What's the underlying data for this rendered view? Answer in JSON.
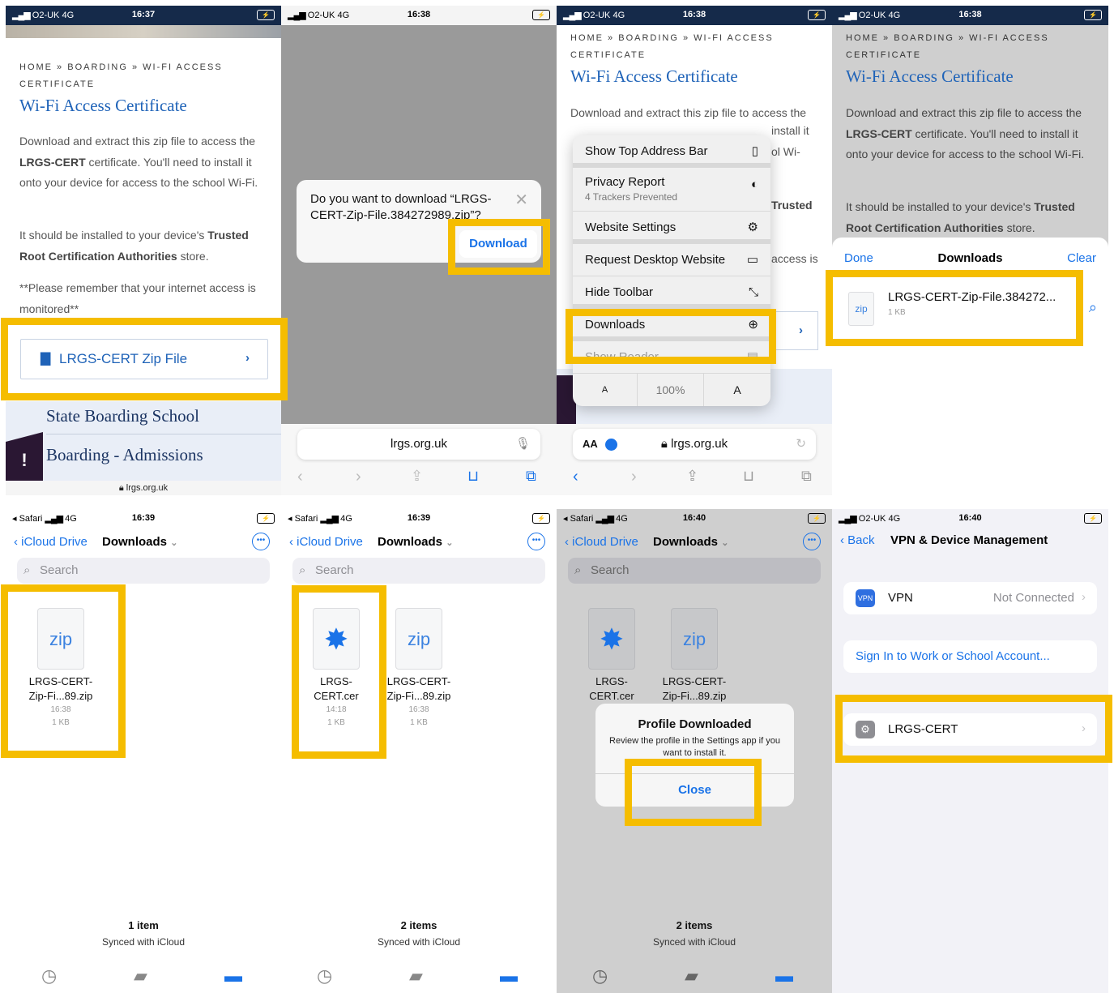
{
  "panel1": {
    "status": {
      "carrier": "O2-UK",
      "network": "4G",
      "time": "16:37"
    },
    "breadcrumb_line1": "HOME » BOARDING » WI-FI ACCESS",
    "breadcrumb_line2": "CERTIFICATE",
    "title": "Wi-Fi Access Certificate",
    "para1_a": "Download and extract this zip file to access the ",
    "para1_b": "LRGS-CERT",
    "para1_c": " certificate. You'll need to install it onto your device for access to the school Wi-Fi.",
    "para2_a": "It should be installed to your device's ",
    "para2_b": "Trusted Root Certification Authorities",
    "para2_c": " store.",
    "para3": "**Please remember that your internet access is monitored**",
    "button_label": "LRGS-CERT Zip File",
    "link1": "State Boarding School",
    "link2": "Boarding - Admissions",
    "url": "lrgs.org.uk"
  },
  "panel2": {
    "status": {
      "carrier": "O2-UK",
      "network": "4G",
      "time": "16:38"
    },
    "dialog_text": "Do you want to download “LRGS-CERT-Zip-File.384272989.zip”?",
    "download_label": "Download",
    "url": "lrgs.org.uk"
  },
  "panel3": {
    "status": {
      "carrier": "O2-UK",
      "network": "4G",
      "time": "16:38"
    },
    "menu": {
      "show_top_address_bar": "Show Top Address Bar",
      "privacy_report": "Privacy Report",
      "privacy_sub": "4 Trackers Prevented",
      "website_settings": "Website Settings",
      "request_desktop": "Request Desktop Website",
      "hide_toolbar": "Hide Toolbar",
      "downloads": "Downloads",
      "show_reader": "Show Reader",
      "zoom_small": "A",
      "zoom_level": "100%",
      "zoom_large": "A"
    },
    "visible_fragments": {
      "install": "install it",
      "wifi": "ol Wi-",
      "trusted": "Trusted",
      "access": "access is"
    },
    "aa_label": "AA",
    "url": "lrgs.org.uk"
  },
  "panel4": {
    "status": {
      "carrier": "O2-UK",
      "network": "4G",
      "time": "16:38"
    },
    "sheet": {
      "done": "Done",
      "title": "Downloads",
      "clear": "Clear"
    },
    "file_name": "LRGS-CERT-Zip-File.384272...",
    "file_size": "1 KB",
    "zip_label": "zip"
  },
  "panel5": {
    "status": {
      "carrier": "Safari",
      "network": "4G",
      "time": "16:39"
    },
    "back_label": "iCloud Drive",
    "title": "Downloads",
    "search_placeholder": "Search",
    "file": {
      "icon_label": "zip",
      "name_line1": "LRGS-CERT-",
      "name_line2": "Zip-Fi...89.zip",
      "time": "16:38",
      "size": "1 KB"
    },
    "count": "1 item",
    "sync": "Synced with iCloud"
  },
  "panel6": {
    "status": {
      "carrier": "Safari",
      "network": "4G",
      "time": "16:39"
    },
    "back_label": "iCloud Drive",
    "title": "Downloads",
    "search_placeholder": "Search",
    "cert": {
      "name_line1": "LRGS-",
      "name_line2": "CERT.cer",
      "time": "14:18",
      "size": "1 KB"
    },
    "zip": {
      "icon_label": "zip",
      "name_line1": "LRGS-CERT-",
      "name_line2": "Zip-Fi...89.zip",
      "time": "16:38",
      "size": "1 KB"
    },
    "count": "2 items",
    "sync": "Synced with iCloud"
  },
  "panel7": {
    "status": {
      "carrier": "Safari",
      "network": "4G",
      "time": "16:40"
    },
    "back_label": "iCloud Drive",
    "title": "Downloads",
    "search_placeholder": "Search",
    "cert": {
      "name_line1": "LRGS-",
      "name_line2": "CERT.cer"
    },
    "zip": {
      "icon_label": "zip",
      "name_line1": "LRGS-CERT-",
      "name_line2": "Zip-Fi...89.zip"
    },
    "alert": {
      "title": "Profile Downloaded",
      "body": "Review the profile in the Settings app if you want to install it.",
      "close": "Close"
    },
    "count": "2 items",
    "sync": "Synced with iCloud"
  },
  "panel8": {
    "status": {
      "carrier": "O2-UK",
      "network": "4G",
      "time": "16:40"
    },
    "back_label": "Back",
    "title": "VPN & Device Management",
    "vpn_badge": "VPN",
    "vpn_label": "VPN",
    "vpn_status": "Not Connected",
    "sign_in": "Sign In to Work or School Account...",
    "profile": "LRGS-CERT"
  },
  "colors": {
    "highlight": "#f5bd00",
    "link": "#1a73e8",
    "title": "#1f63b8",
    "status_bar": "#152a4a"
  }
}
